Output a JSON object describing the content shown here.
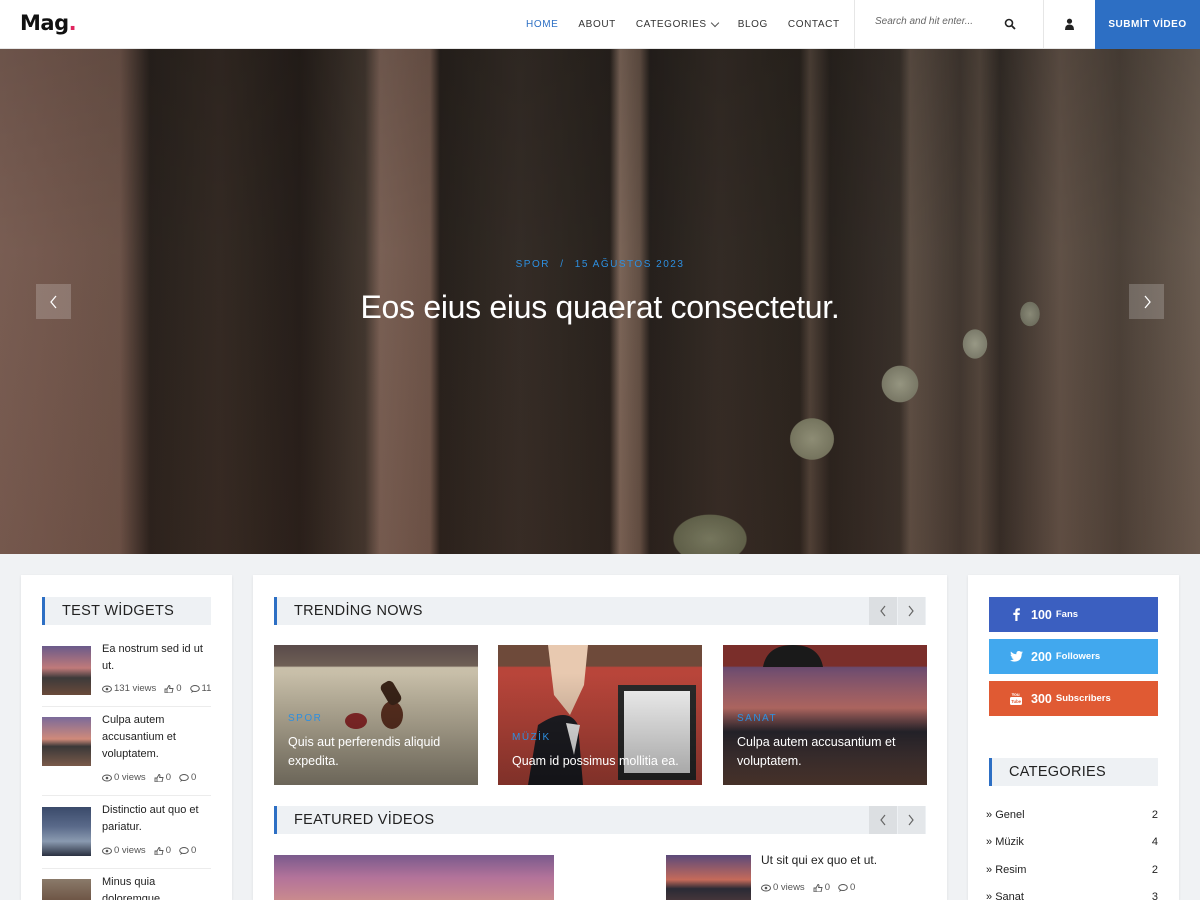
{
  "header": {
    "logo_text": "Mag",
    "logo_dot": ".",
    "nav": [
      {
        "label": "HOME",
        "active": true
      },
      {
        "label": "ABOUT",
        "active": false
      },
      {
        "label": "CATEGORIES",
        "active": false
      },
      {
        "label": "BLOG",
        "active": false
      },
      {
        "label": "CONTACT",
        "active": false
      }
    ],
    "search_placeholder": "Search and hit enter...",
    "submit_label": "SUBMİT VİDEO",
    "accent_color": "#2d6fc4"
  },
  "hero": {
    "category": "SPOR",
    "separator": "/",
    "date": "15 AĞUSTOS 2023",
    "title": "Eos eius eius quaerat consectetur."
  },
  "left_widget": {
    "title": "TEST WİDGETS",
    "items": [
      {
        "title": "Ea nostrum sed id ut ut.",
        "views": "131 views",
        "likes": "0",
        "comments": "11"
      },
      {
        "title": "Culpa autem accusantium et voluptatem.",
        "views": "0 views",
        "likes": "0",
        "comments": "0"
      },
      {
        "title": "Distinctio aut quo et pariatur.",
        "views": "0 views",
        "likes": "0",
        "comments": "0"
      },
      {
        "title": "Minus quia doloremque"
      }
    ]
  },
  "trending": {
    "title": "TRENDİNG NOWS",
    "cards": [
      {
        "tag": "SPOR",
        "title": "Quis aut perferendis aliquid expedita."
      },
      {
        "tag": "MÜZİK",
        "title": "Quam id possimus mollitia ea."
      },
      {
        "tag": "SANAT",
        "title": "Culpa autem accusantium et voluptatem."
      }
    ]
  },
  "featured": {
    "title": "FEATURED VİDEOS",
    "side_item": {
      "title": "Ut sit qui ex quo et ut.",
      "views": "0 views",
      "likes": "0",
      "comments": "0"
    }
  },
  "social": [
    {
      "count": "100",
      "label": "Fans",
      "color": "#3b5fc0",
      "icon": "facebook-icon"
    },
    {
      "count": "200",
      "label": "Followers",
      "color": "#41a8ee",
      "icon": "twitter-icon"
    },
    {
      "count": "300",
      "label": "Subscribers",
      "color": "#e05a33",
      "icon": "youtube-icon"
    }
  ],
  "categories": {
    "title": "CATEGORIES",
    "items": [
      {
        "name": "Genel",
        "count": "2"
      },
      {
        "name": "Müzik",
        "count": "4"
      },
      {
        "name": "Resim",
        "count": "2"
      },
      {
        "name": "Sanat",
        "count": "3"
      }
    ]
  }
}
